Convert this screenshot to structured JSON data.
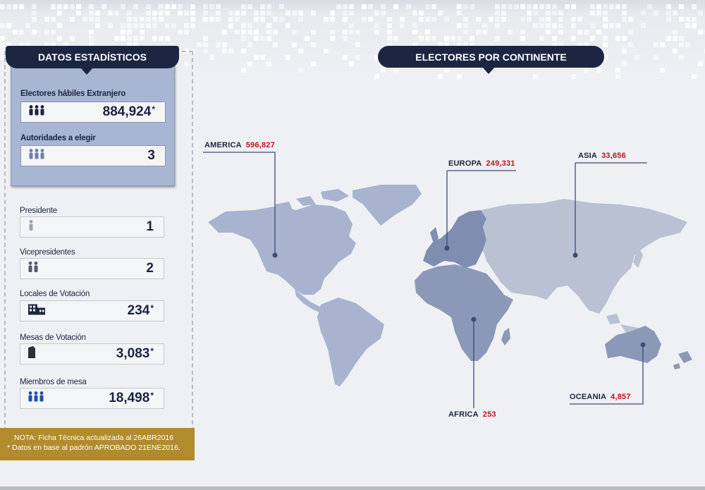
{
  "panel": {
    "title": "DATOS ESTADÍSTICOS",
    "electores_label": "Electores hábiles Extranjero",
    "electores_value": "884,924",
    "electores_mark": "*",
    "autoridades_label": "Autoridades a elegir",
    "autoridades_value": "3"
  },
  "stats": [
    {
      "label": "Presidente",
      "value": "1",
      "mark": "",
      "icon": "person-icon"
    },
    {
      "label": "Vicepresidentes",
      "value": "2",
      "mark": "",
      "icon": "two-persons-icon"
    },
    {
      "label": "Locales de Votación",
      "value": "234",
      "mark": "*",
      "icon": "building-icon"
    },
    {
      "label": "Mesas de Votación",
      "value": "3,083",
      "mark": "*",
      "icon": "ballot-box-icon"
    },
    {
      "label": "Miembros de mesa",
      "value": "18,498",
      "mark": "*",
      "icon": "group-icon"
    }
  ],
  "note": {
    "line1": "NOTA: Ficha Técnica actualizada al 26ABR2016",
    "line2": "* Datos en base al padrón APROBADO 21ENE2016."
  },
  "map": {
    "title": "ELECTORES POR CONTINENTE",
    "continents": [
      {
        "name": "AMERICA",
        "value": "596,827"
      },
      {
        "name": "EUROPA",
        "value": "249,331"
      },
      {
        "name": "ASIA",
        "value": "33,656"
      },
      {
        "name": "AFRICA",
        "value": "253"
      },
      {
        "name": "OCEANIA",
        "value": "4,857"
      }
    ]
  },
  "colors": {
    "navy": "#1c2541",
    "panel": "#a9b6d3",
    "gold": "#b28b2d",
    "value_red": "#c0121f"
  }
}
